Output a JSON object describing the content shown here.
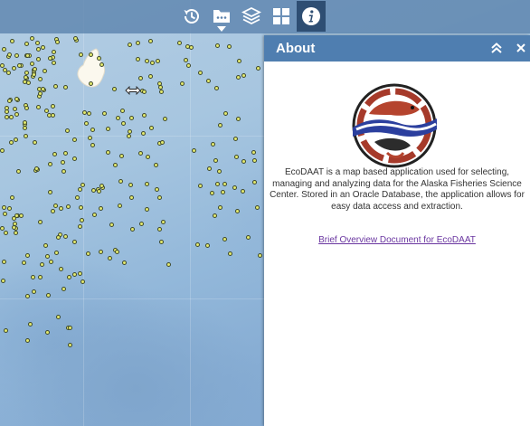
{
  "toolbar": {
    "buttons": [
      {
        "name": "history",
        "active": false
      },
      {
        "name": "layer-list",
        "active": false
      },
      {
        "name": "layers",
        "active": false
      },
      {
        "name": "basemap-gallery",
        "active": false
      },
      {
        "name": "about",
        "active": true
      }
    ]
  },
  "panel": {
    "title": "About",
    "description": "EcoDAAT is a map based application used for selecting, managing and analyzing data for the Alaska Fisheries Science Center. Stored in an Oracle Database, the application allows for easy data access and extraction.",
    "link_text": "Brief Overview Document for EcoDAAT"
  },
  "colors": {
    "panel_header": "#4f7eb0",
    "toolbar_active": "#2e4e73",
    "link": "#6a36a0",
    "point_fill": "#e4ea6e"
  }
}
